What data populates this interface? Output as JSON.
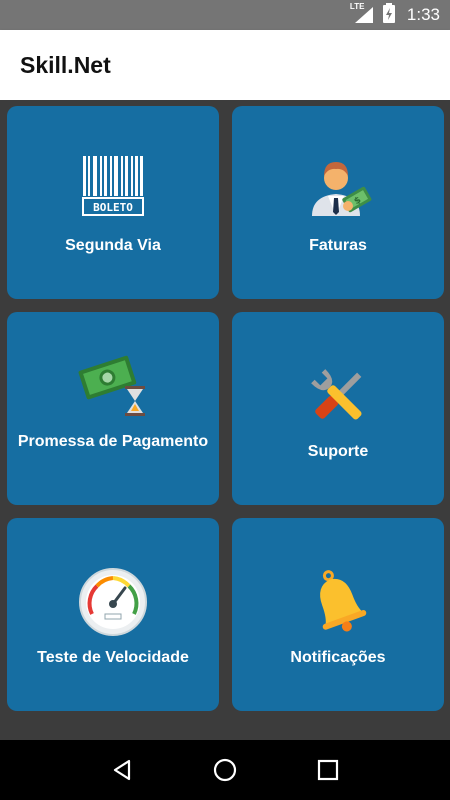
{
  "status_bar": {
    "network": "LTE",
    "time": "1:33",
    "icons": [
      "lte-signal-icon",
      "battery-charging-icon"
    ]
  },
  "app_bar": {
    "title": "Skill.Net"
  },
  "tiles": [
    {
      "label": "Segunda Via",
      "icon": "boleto-barcode-icon",
      "icon_text": "BOLETO"
    },
    {
      "label": "Faturas",
      "icon": "businessman-money-icon"
    },
    {
      "label": "Promessa de Pagamento",
      "icon": "money-hourglass-icon"
    },
    {
      "label": "Suporte",
      "icon": "tools-icon"
    },
    {
      "label": "Teste de Velocidade",
      "icon": "speedometer-icon"
    },
    {
      "label": "Notificações",
      "icon": "bell-icon"
    }
  ],
  "nav_bar": {
    "icons": [
      "back-icon",
      "home-icon",
      "recents-icon"
    ]
  },
  "colors": {
    "tile": "#166ea2",
    "background": "#3c3c3c",
    "status_bar": "#757575",
    "nav_bar": "#000000"
  }
}
